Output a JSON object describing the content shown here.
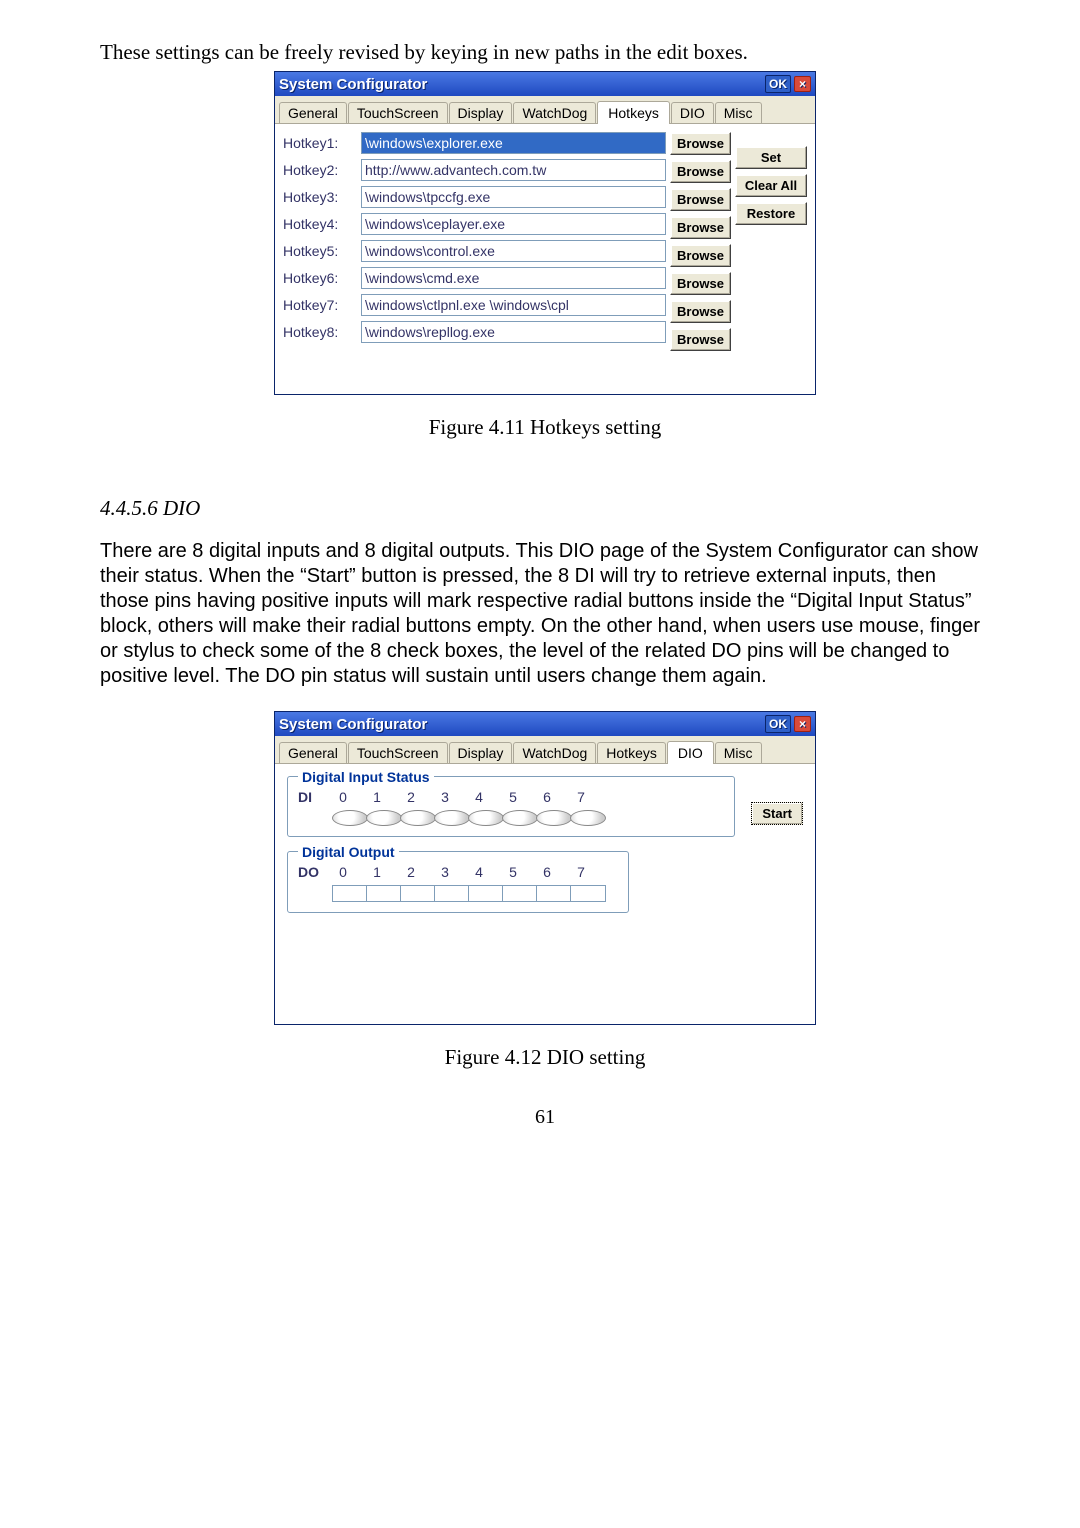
{
  "intro_text": "These settings can be freely revised by keying in new paths in the edit boxes.",
  "window": {
    "title": "System Configurator",
    "ok": "OK",
    "close": "×",
    "tabs": [
      "General",
      "TouchScreen",
      "Display",
      "WatchDog",
      "Hotkeys",
      "DIO",
      "Misc"
    ],
    "active_hotkeys": "Hotkeys",
    "active_dio": "DIO"
  },
  "hotkeys": {
    "rows": [
      {
        "label": "Hotkey1:",
        "value": "\\windows\\explorer.exe",
        "selected": true
      },
      {
        "label": "Hotkey2:",
        "value": "http://www.advantech.com.tw"
      },
      {
        "label": "Hotkey3:",
        "value": "\\windows\\tpccfg.exe"
      },
      {
        "label": "Hotkey4:",
        "value": "\\windows\\ceplayer.exe"
      },
      {
        "label": "Hotkey5:",
        "value": "\\windows\\control.exe"
      },
      {
        "label": "Hotkey6:",
        "value": "\\windows\\cmd.exe"
      },
      {
        "label": "Hotkey7:",
        "value": "\\windows\\ctlpnl.exe \\windows\\cpl"
      },
      {
        "label": "Hotkey8:",
        "value": "\\windows\\repllog.exe"
      }
    ],
    "browse_label": "Browse",
    "set_label": "Set",
    "clear_label": "Clear All",
    "restore_label": "Restore"
  },
  "figcap1": "Figure 4.11 Hotkeys setting",
  "section_heading": "4.4.5.6 DIO",
  "dio_paragraph": "There are 8 digital inputs and 8 digital outputs. This DIO page of the System Configurator can show their status. When the “Start” button is pressed, the 8 DI will try to retrieve external inputs, then those pins having positive inputs will mark respective radial buttons inside the “Digital Input Status” block, others will make their radial buttons empty. On the other hand, when users use mouse, finger or stylus to check some of the 8 check boxes, the level of the related DO pins will be changed to positive level. The DO pin status will sustain until users change them again.",
  "dio": {
    "di_legend": "Digital Input Status",
    "di_label": "DI",
    "do_legend": "Digital Output",
    "do_label": "DO",
    "indices": [
      "0",
      "1",
      "2",
      "3",
      "4",
      "5",
      "6",
      "7"
    ],
    "start_label": "Start"
  },
  "figcap2": "Figure 4.12 DIO setting",
  "page_number": "61"
}
